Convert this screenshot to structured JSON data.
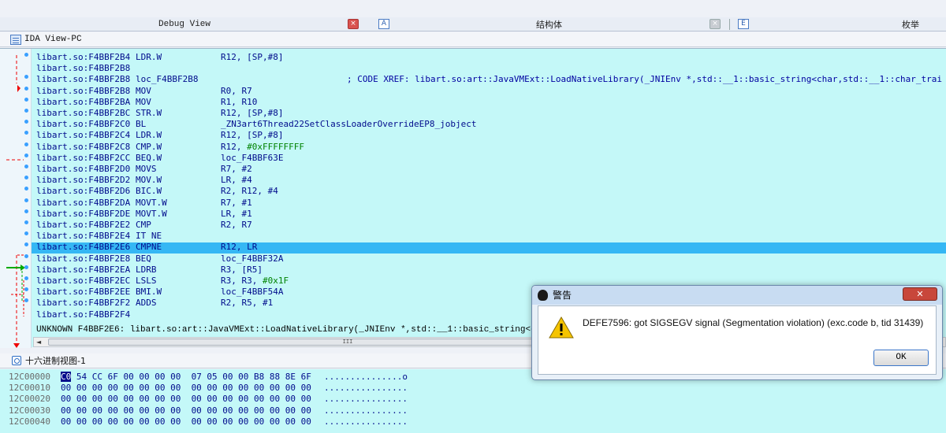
{
  "tabs": {
    "debug_view": "Debug View",
    "debug_close": "×",
    "struct_icon": "A",
    "struct": "结构体",
    "struct_close": "×",
    "enum_icon": "E",
    "enum": "枚举"
  },
  "ida_view": {
    "title": "IDA View-PC",
    "lines": [
      {
        "addr": "libart.so:F4BBF2B4",
        "mnem": "LDR.W",
        "ops": "R12, [SP,#8]"
      },
      {
        "addr": "libart.so:F4BBF2B8",
        "mnem": "",
        "ops": ""
      },
      {
        "addr": "libart.so:F4BBF2B8",
        "mnem": "loc_F4BBF2B8",
        "ops": "",
        "comment": "; CODE XREF: libart.so:art::JavaVMExt::LoadNativeLibrary(_JNIEnv *,std::__1::basic_string<char,std::__1::char_trai"
      },
      {
        "addr": "libart.so:F4BBF2B8",
        "mnem": "MOV",
        "ops": "R0, R7"
      },
      {
        "addr": "libart.so:F4BBF2BA",
        "mnem": "MOV",
        "ops": "R1, R10"
      },
      {
        "addr": "libart.so:F4BBF2BC",
        "mnem": "STR.W",
        "ops": "R12, [SP,#8]"
      },
      {
        "addr": "libart.so:F4BBF2C0",
        "mnem": "BL",
        "ops": "_ZN3art6Thread22SetClassLoaderOverrideEP8_jobject"
      },
      {
        "addr": "libart.so:F4BBF2C4",
        "mnem": "LDR.W",
        "ops": "R12, [SP,#8]"
      },
      {
        "addr": "libart.so:F4BBF2C8",
        "mnem": "CMP.W",
        "ops": "R12, ",
        "num": "#0xFFFFFFFF"
      },
      {
        "addr": "libart.so:F4BBF2CC",
        "mnem": "BEQ.W",
        "ops": "loc_F4BBF63E"
      },
      {
        "addr": "libart.so:F4BBF2D0",
        "mnem": "MOVS",
        "ops": "R7, #2"
      },
      {
        "addr": "libart.so:F4BBF2D2",
        "mnem": "MOV.W",
        "ops": "LR, #4"
      },
      {
        "addr": "libart.so:F4BBF2D6",
        "mnem": "BIC.W",
        "ops": "R2, R12, #4"
      },
      {
        "addr": "libart.so:F4BBF2DA",
        "mnem": "MOVT.W",
        "ops": "R7, #1"
      },
      {
        "addr": "libart.so:F4BBF2DE",
        "mnem": "MOVT.W",
        "ops": "LR, #1"
      },
      {
        "addr": "libart.so:F4BBF2E2",
        "mnem": "CMP",
        "ops": "R2, R7"
      },
      {
        "addr": "libart.so:F4BBF2E4",
        "mnem": "IT NE",
        "ops": ""
      },
      {
        "addr": "libart.so:F4BBF2E6",
        "mnem": "CMPNE",
        "ops": "R12, LR"
      },
      {
        "addr": "libart.so:F4BBF2E8",
        "mnem": "BEQ",
        "ops": "loc_F4BBF32A"
      },
      {
        "addr": "libart.so:F4BBF2EA",
        "mnem": "LDRB",
        "ops": "R3, [R5]"
      },
      {
        "addr": "libart.so:F4BBF2EC",
        "mnem": "LSLS",
        "ops": "R3, R3, ",
        "num": "#0x1F"
      },
      {
        "addr": "libart.so:F4BBF2EE",
        "mnem": "BMI.W",
        "ops": "loc_F4BBF54A"
      },
      {
        "addr": "libart.so:F4BBF2F2",
        "mnem": "ADDS",
        "ops": "R2, R5, #1"
      },
      {
        "addr": "libart.so:F4BBF2F4",
        "mnem": "",
        "ops": ""
      }
    ],
    "status": "UNKNOWN F4BBF2E6: libart.so:art::JavaVMExt::LoadNativeLibrary(_JNIEnv *,std::__1::basic_string<char,std::__1::",
    "scroll_left": "◄",
    "scroll_thumb": "III"
  },
  "hex_view": {
    "title": "十六进制视图-1",
    "rows": [
      {
        "addr": "12C00000",
        "cur": "C0",
        "bytes": " 54 CC 6F 00 00 00 00  07 05 00 00 B8 88 8E 6F",
        "ascii": "...............o"
      },
      {
        "addr": "12C00010",
        "cur": "",
        "bytes": "00 00 00 00 00 00 00 00  00 00 00 00 00 00 00 00",
        "ascii": "................"
      },
      {
        "addr": "12C00020",
        "cur": "",
        "bytes": "00 00 00 00 00 00 00 00  00 00 00 00 00 00 00 00",
        "ascii": "................"
      },
      {
        "addr": "12C00030",
        "cur": "",
        "bytes": "00 00 00 00 00 00 00 00  00 00 00 00 00 00 00 00",
        "ascii": "................"
      },
      {
        "addr": "12C00040",
        "cur": "",
        "bytes": "00 00 00 00 00 00 00 00  00 00 00 00 00 00 00 00",
        "ascii": "................"
      }
    ]
  },
  "dialog": {
    "title": "警告",
    "close": "✕",
    "message": "DEFE7596: got SIGSEGV signal (Segmentation violation) (exc.code b, tid 31439)",
    "ok": "OK"
  }
}
